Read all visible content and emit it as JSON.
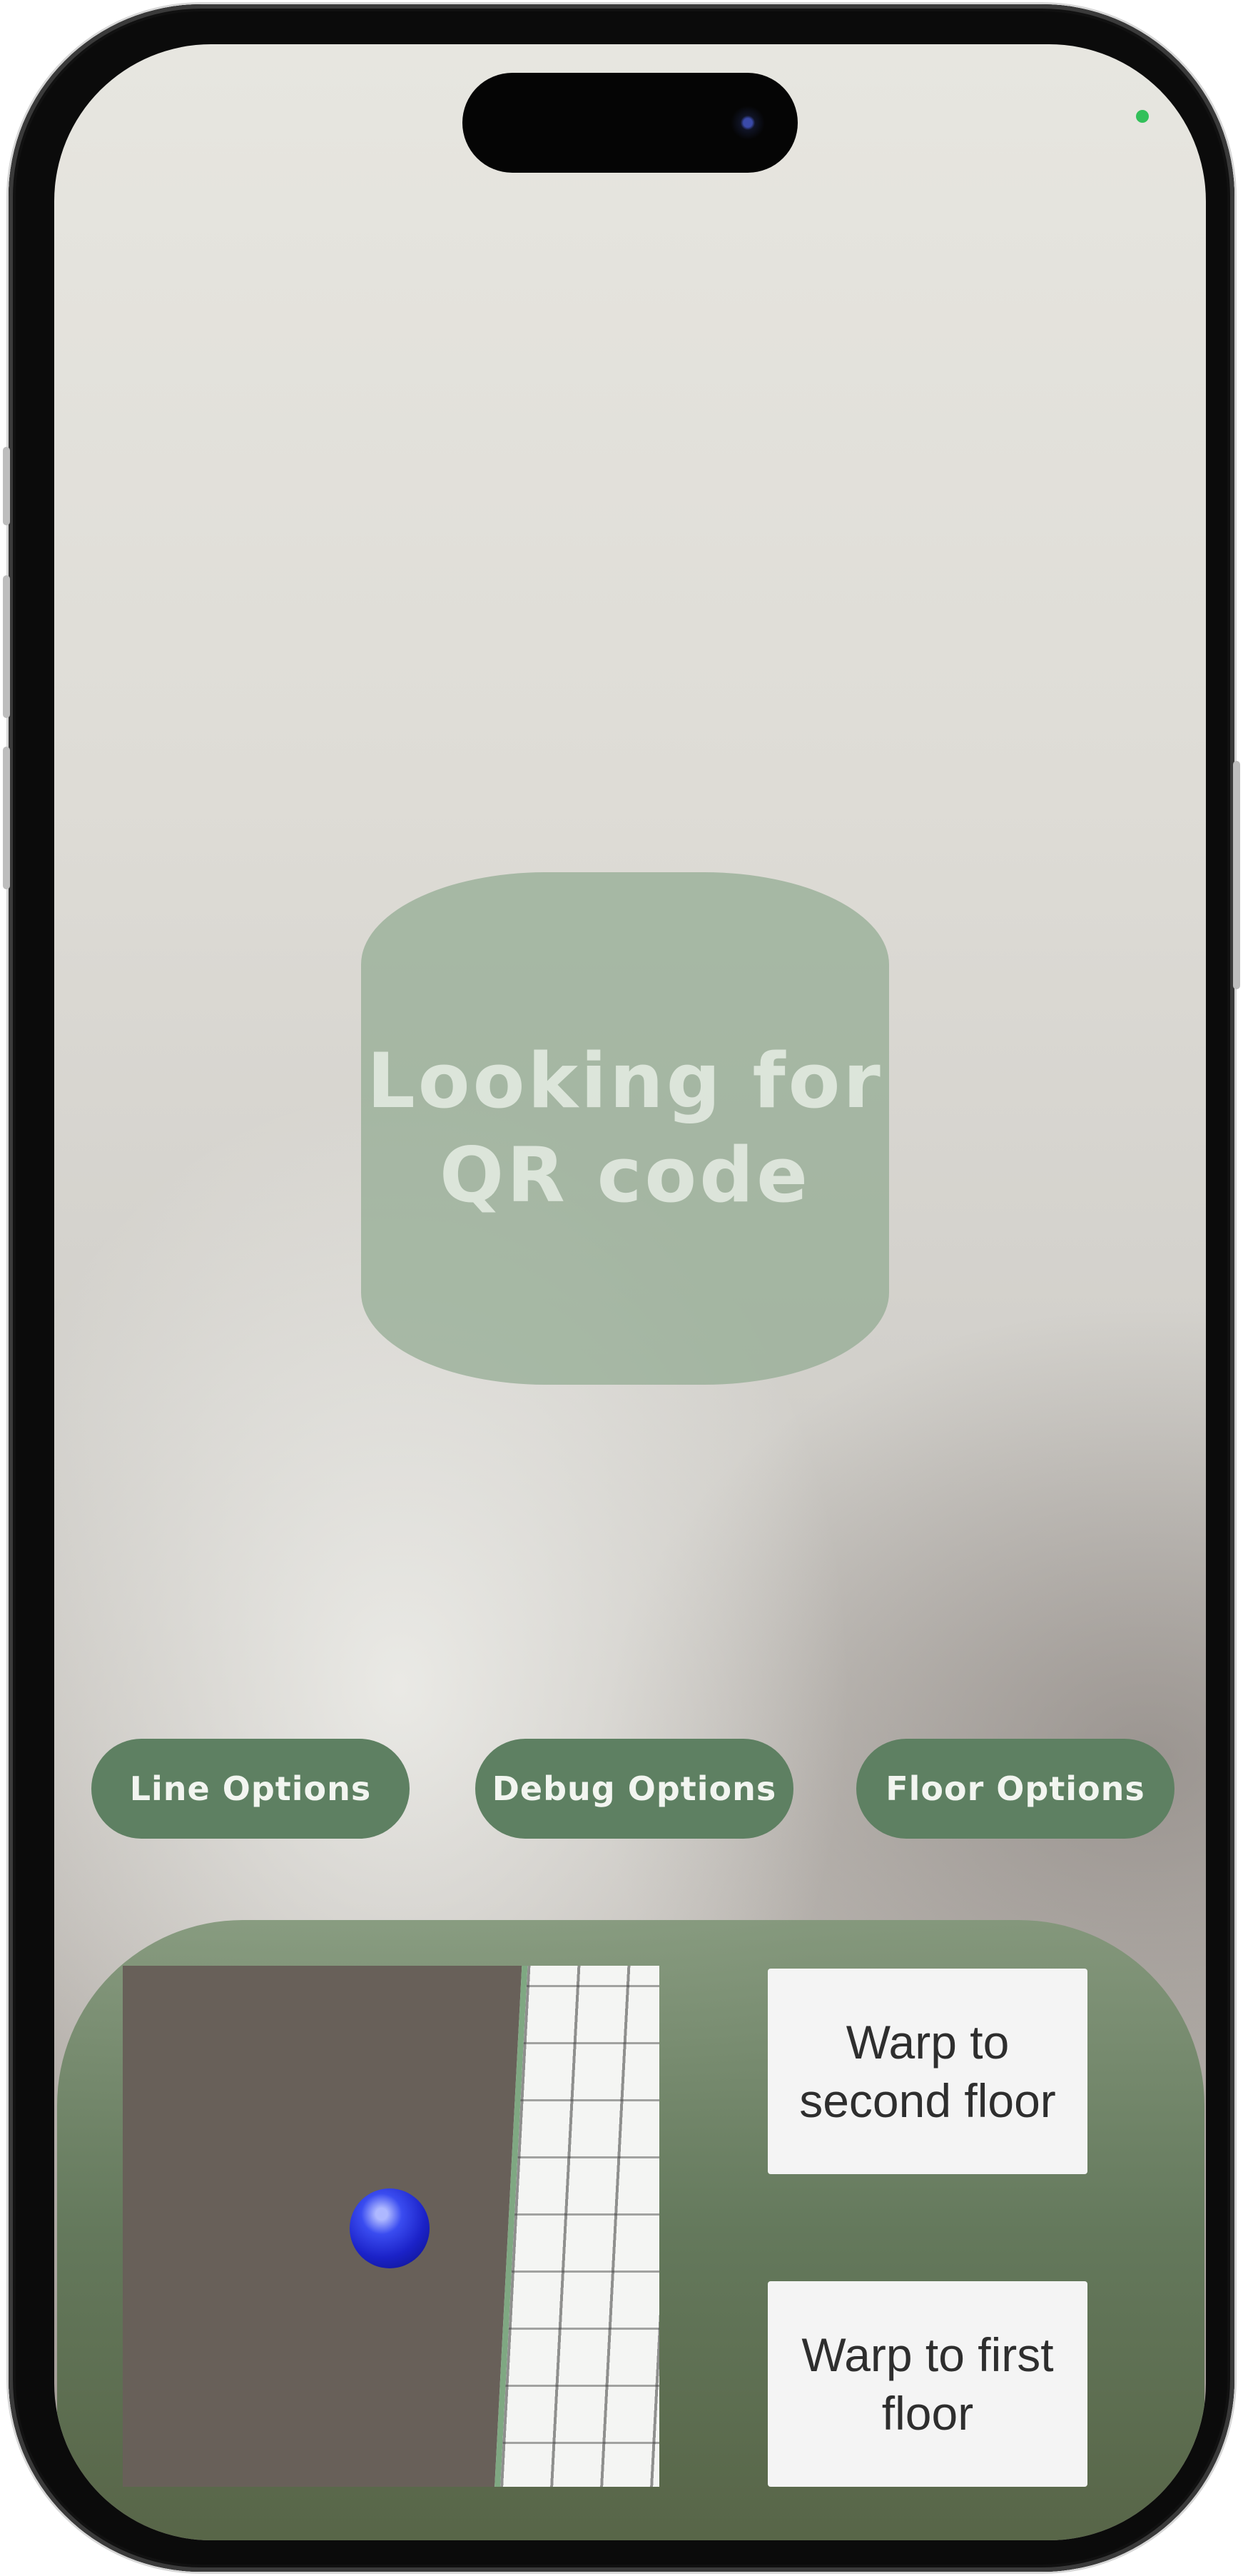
{
  "scan_status": {
    "message": "Looking for\nQR code"
  },
  "options_bar": {
    "line_options": "Line Options",
    "debug_options": "Debug Options",
    "floor_options": "Floor Options"
  },
  "bottom_panel": {
    "warp_second_floor": "Warp to\nsecond floor",
    "warp_first_floor": "Warp to first\nfloor"
  },
  "colors": {
    "accent_green": "#5e8062",
    "privacy_indicator": "#33c05a",
    "avatar_blue": "#1b22c8"
  },
  "icons": {
    "camera": "front-camera-icon",
    "privacy": "camera-in-use-indicator",
    "avatar": "player-position-marker"
  }
}
